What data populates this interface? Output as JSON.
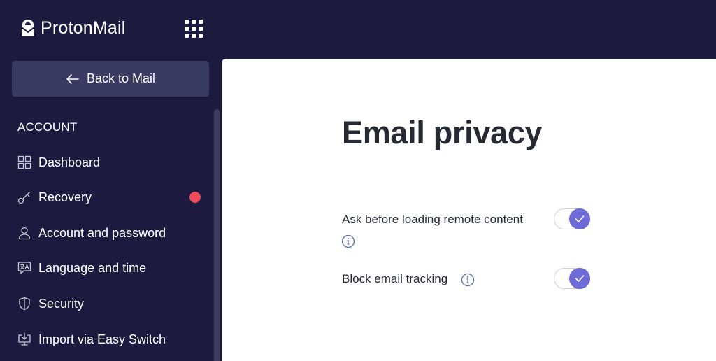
{
  "header": {
    "logo_text": "ProtonMail",
    "apps_icon": "grid-apps-icon"
  },
  "sidebar": {
    "back_label": "Back to Mail",
    "section_title": "ACCOUNT",
    "items": [
      {
        "label": "Dashboard",
        "icon": "dashboard-icon"
      },
      {
        "label": "Recovery",
        "icon": "key-icon",
        "alert": true
      },
      {
        "label": "Account and password",
        "icon": "user-icon"
      },
      {
        "label": "Language and time",
        "icon": "language-icon"
      },
      {
        "label": "Security",
        "icon": "shield-icon"
      },
      {
        "label": "Import via Easy Switch",
        "icon": "import-icon"
      }
    ]
  },
  "main": {
    "title": "Email privacy",
    "settings": [
      {
        "label": "Ask before loading remote content",
        "enabled": true
      },
      {
        "label": "Block email tracking",
        "enabled": true
      }
    ]
  },
  "colors": {
    "sidebar_bg": "#1c1b3f",
    "back_button_bg": "#3a3b63",
    "accent": "#6d6bd8",
    "alert_dot": "#ef4b5b",
    "text_dark": "#262a33"
  }
}
